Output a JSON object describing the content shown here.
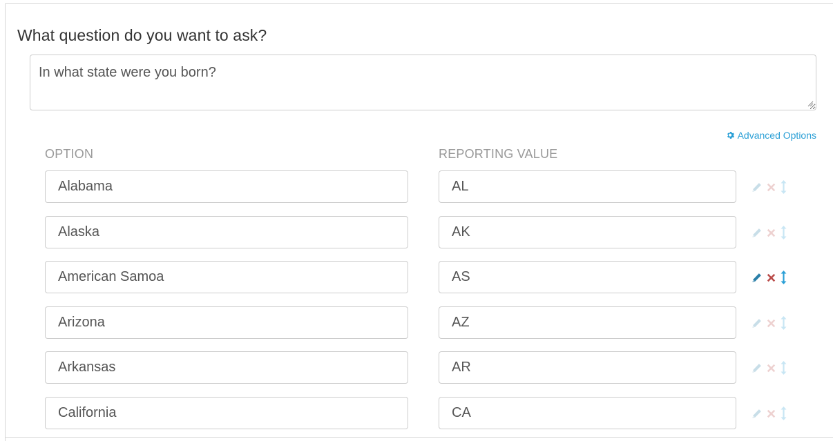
{
  "question": {
    "label": "What question do you want to ask?",
    "value": "In what state were you born?"
  },
  "advanced_options": {
    "label": "Advanced Options",
    "icon": "gear-icon"
  },
  "columns": {
    "option": "OPTION",
    "reporting_value": "REPORTING VALUE"
  },
  "options": [
    {
      "option": "Alabama",
      "value": "AL",
      "active": false
    },
    {
      "option": "Alaska",
      "value": "AK",
      "active": false
    },
    {
      "option": "American Samoa",
      "value": "AS",
      "active": true
    },
    {
      "option": "Arizona",
      "value": "AZ",
      "active": false
    },
    {
      "option": "Arkansas",
      "value": "AR",
      "active": false
    },
    {
      "option": "California",
      "value": "CA",
      "active": false
    }
  ],
  "row_actions": {
    "edit_icon": "pencil-icon",
    "delete_icon": "delete-x-icon",
    "reorder_icon": "reorder-arrows-icon"
  },
  "colors": {
    "accent": "#2a9fd6",
    "edit": "#2a7fa8",
    "delete": "#b94a48",
    "reorder": "#2a9fd6",
    "border": "#cccccc",
    "header": "#999999"
  }
}
